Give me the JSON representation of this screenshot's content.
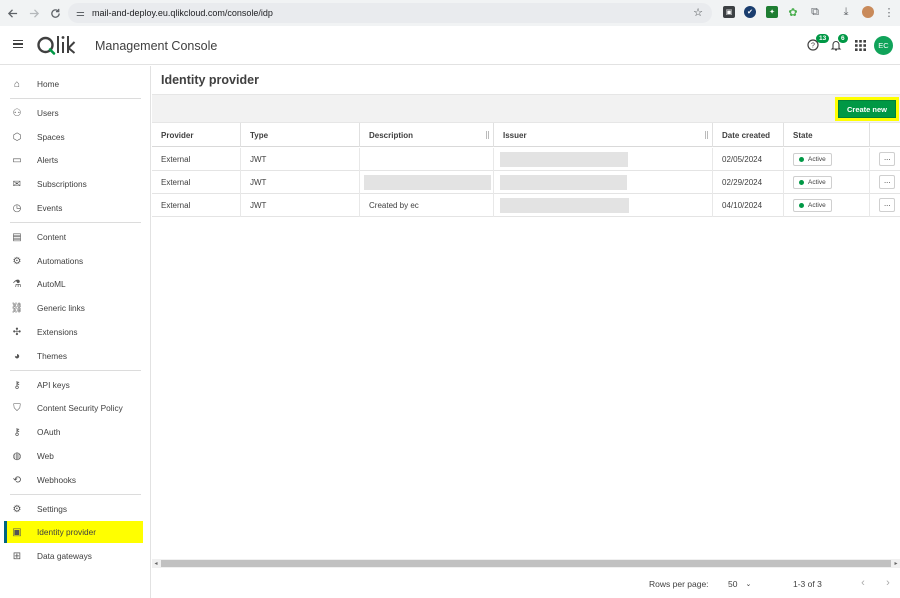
{
  "browser": {
    "url": "mail-and-deploy.eu.qlikcloud.com/console/idp",
    "back_icon": "arrow-left",
    "forward_icon": "arrow-right",
    "reload_icon": "reload",
    "extensions": [
      {
        "name": "ext-1",
        "glyph": "▣",
        "color": "#3c4043"
      },
      {
        "name": "ext-2",
        "glyph": "✔",
        "color": "#1a3d6e"
      },
      {
        "name": "ext-3",
        "glyph": "✦",
        "color": "#1e7d32"
      },
      {
        "name": "ext-4",
        "glyph": "✿",
        "color": "#4caf50"
      }
    ]
  },
  "header": {
    "app_title": "Management Console",
    "help_badge": "13",
    "notif_badge": "6",
    "avatar_initials": "EC",
    "accent": "#009845"
  },
  "sidebar": {
    "items": [
      {
        "label": "Home",
        "icon": "home-icon"
      },
      {
        "label": "Users",
        "icon": "users-icon"
      },
      {
        "label": "Spaces",
        "icon": "spaces-icon"
      },
      {
        "label": "Alerts",
        "icon": "alerts-icon"
      },
      {
        "label": "Subscriptions",
        "icon": "mail-icon"
      },
      {
        "label": "Events",
        "icon": "clock-icon"
      },
      {
        "label": "Content",
        "icon": "content-icon"
      },
      {
        "label": "Automations",
        "icon": "automation-icon"
      },
      {
        "label": "AutoML",
        "icon": "flask-icon"
      },
      {
        "label": "Generic links",
        "icon": "link-icon"
      },
      {
        "label": "Extensions",
        "icon": "puzzle-icon"
      },
      {
        "label": "Themes",
        "icon": "palette-icon"
      },
      {
        "label": "API keys",
        "icon": "key-icon"
      },
      {
        "label": "Content Security Policy",
        "icon": "shield-icon"
      },
      {
        "label": "OAuth",
        "icon": "oauth-key-icon"
      },
      {
        "label": "Web",
        "icon": "globe-icon"
      },
      {
        "label": "Webhooks",
        "icon": "webhook-icon"
      },
      {
        "label": "Settings",
        "icon": "gear-icon"
      },
      {
        "label": "Identity provider",
        "icon": "id-card-icon"
      },
      {
        "label": "Data gateways",
        "icon": "gateway-icon"
      }
    ]
  },
  "main": {
    "title": "Identity provider",
    "create_label": "Create new",
    "columns": [
      "Provider",
      "Type",
      "Description",
      "Issuer",
      "Date created",
      "State"
    ],
    "rows": [
      {
        "provider": "External",
        "type": "JWT",
        "description": "",
        "date": "02/05/2024",
        "state": "Active"
      },
      {
        "provider": "External",
        "type": "JWT",
        "description": "",
        "date": "02/29/2024",
        "state": "Active"
      },
      {
        "provider": "External",
        "type": "JWT",
        "description": "Created by ec",
        "date": "04/10/2024",
        "state": "Active"
      }
    ],
    "more_label": "···",
    "pager": {
      "rows_label": "Rows per page:",
      "rows_value": "50",
      "range": "1-3 of 3"
    }
  }
}
